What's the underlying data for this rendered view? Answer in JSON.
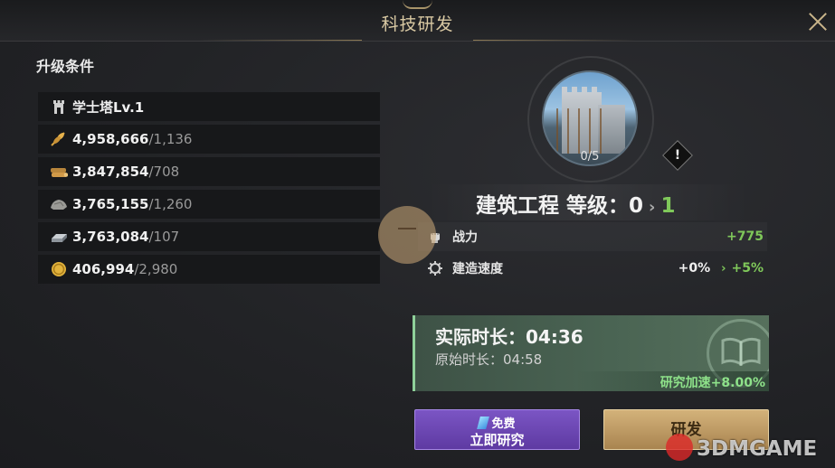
{
  "header": {
    "title": "科技研发"
  },
  "requirements": {
    "title": "升级条件",
    "building": {
      "label": "学士塔Lv.1",
      "icon": "tower-icon"
    },
    "resources": [
      {
        "icon": "wheat-icon",
        "have": "4,958,666",
        "need": "/1,136"
      },
      {
        "icon": "wood-icon",
        "have": "3,847,854",
        "need": "/708"
      },
      {
        "icon": "stone-icon",
        "have": "3,765,155",
        "need": "/1,260"
      },
      {
        "icon": "iron-icon",
        "have": "3,763,084",
        "need": "/107"
      },
      {
        "icon": "gold-coin-icon",
        "have": "406,994",
        "need": "/2,980"
      }
    ]
  },
  "tech": {
    "progress": "0/5",
    "info_symbol": "!",
    "name": "建筑工程 等级：0",
    "next_level": "1",
    "stats": [
      {
        "icon": "fist-icon",
        "label": "战力",
        "current": "",
        "bonus": "+775"
      },
      {
        "icon": "gear-icon",
        "label": "建造速度",
        "current": "+0%",
        "bonus": "+5%"
      }
    ]
  },
  "timing": {
    "actual": "实际时长：04:36",
    "original": "原始时长：04:58",
    "speed_bonus": "研究加速+8.00%"
  },
  "buttons": {
    "free_line1": "免费",
    "free_line2": "立即研究",
    "research": "研发"
  },
  "watermark": "3DMGAME",
  "colors": {
    "accent_green": "#7fc85a",
    "purple_button": "#6a46b3",
    "gold_button": "#c6a36c",
    "title_gold": "#d9c9a3"
  }
}
